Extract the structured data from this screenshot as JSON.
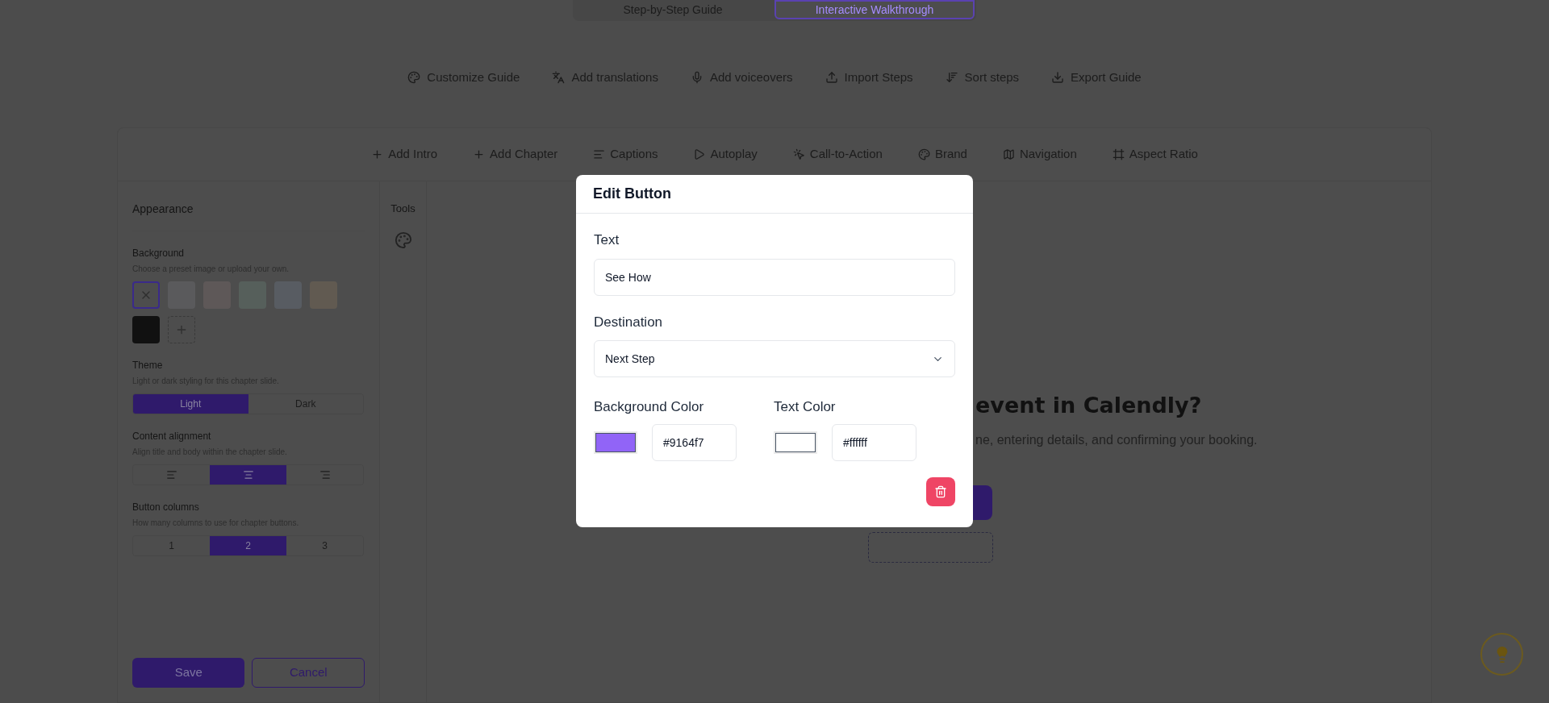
{
  "mode_tabs": [
    {
      "label": "Step-by-Step Guide",
      "selected": false
    },
    {
      "label": "Interactive Walkthrough",
      "selected": true
    }
  ],
  "guide_actions": [
    "Customize Guide",
    "Add translations",
    "Add voiceovers",
    "Import Steps",
    "Sort steps",
    "Export Guide"
  ],
  "toolbar": [
    "Add Intro",
    "Add Chapter",
    "Captions",
    "Autoplay",
    "Call-to-Action",
    "Brand",
    "Navigation",
    "Aspect Ratio"
  ],
  "appearance": {
    "title": "Appearance",
    "background": {
      "label": "Background",
      "hint": "Choose a preset image or upload your own.",
      "swatches": [
        {
          "kind": "none",
          "selected": true
        },
        {
          "kind": "color",
          "color": "#5a5a5c",
          "selected": false
        },
        {
          "kind": "color",
          "color": "#5e5858",
          "selected": false
        },
        {
          "kind": "color",
          "color": "#565f5b",
          "selected": false
        },
        {
          "kind": "color",
          "color": "#585c62",
          "selected": false
        },
        {
          "kind": "color",
          "color": "#615a51",
          "selected": false
        },
        {
          "kind": "color",
          "color": "#111111",
          "selected": false
        },
        {
          "kind": "upload",
          "selected": false
        }
      ]
    },
    "theme": {
      "label": "Theme",
      "hint": "Light or dark styling for this chapter slide.",
      "options": [
        {
          "label": "Light",
          "selected": true
        },
        {
          "label": "Dark",
          "selected": false
        }
      ]
    },
    "alignment": {
      "label": "Content alignment",
      "hint": "Align title and body within the chapter slide.",
      "options": [
        {
          "kind": "left",
          "selected": false
        },
        {
          "kind": "center",
          "selected": true
        },
        {
          "kind": "right",
          "selected": false
        }
      ]
    },
    "columns": {
      "label": "Button columns",
      "hint": "How many columns to use for chapter buttons.",
      "options": [
        {
          "label": "1",
          "selected": false
        },
        {
          "label": "2",
          "selected": true
        },
        {
          "label": "3",
          "selected": false
        }
      ]
    },
    "save": "Save",
    "cancel": "Cancel"
  },
  "tools": {
    "title": "Tools"
  },
  "slide": {
    "heading": "event in Calendly?",
    "subtitle": "ne, entering details, and confirming your booking."
  },
  "dialog": {
    "title": "Edit Button",
    "text": {
      "label": "Text",
      "value": "See How"
    },
    "destination": {
      "label": "Destination",
      "value": "Next Step"
    },
    "background_color": {
      "label": "Background Color",
      "value": "#9164f7"
    },
    "text_color": {
      "label": "Text Color",
      "value": "#ffffff"
    }
  }
}
